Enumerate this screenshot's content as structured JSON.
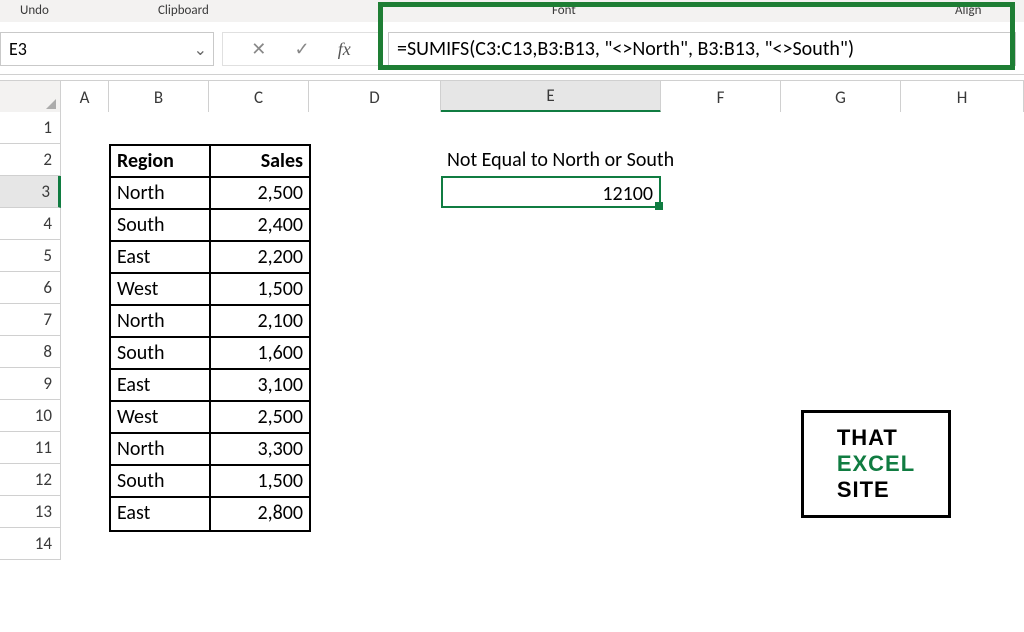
{
  "ribbon": {
    "undo": "Undo",
    "clipboard": "Clipboard",
    "font": "Font",
    "align": "Align"
  },
  "name_box": "E3",
  "formula_bar": "=SUMIFS(C3:C13,B3:B13, \"<>North\", B3:B13, \"<>South\")",
  "columns": {
    "A": "A",
    "B": "B",
    "C": "C",
    "D": "D",
    "E": "E",
    "F": "F",
    "G": "G",
    "H": "H"
  },
  "rows": {
    "1": "1",
    "2": "2",
    "3": "3",
    "4": "4",
    "5": "5",
    "6": "6",
    "7": "7",
    "8": "8",
    "9": "9",
    "10": "10",
    "11": "11",
    "12": "12",
    "13": "13",
    "14": "14"
  },
  "table": {
    "header": {
      "region": "Region",
      "sales": "Sales"
    },
    "rows": [
      {
        "region": "North",
        "sales": "2,500"
      },
      {
        "region": "South",
        "sales": "2,400"
      },
      {
        "region": "East",
        "sales": "2,200"
      },
      {
        "region": "West",
        "sales": "1,500"
      },
      {
        "region": "North",
        "sales": "2,100"
      },
      {
        "region": "South",
        "sales": "1,600"
      },
      {
        "region": "East",
        "sales": "3,100"
      },
      {
        "region": "West",
        "sales": "2,500"
      },
      {
        "region": "North",
        "sales": "3,300"
      },
      {
        "region": "South",
        "sales": "1,500"
      },
      {
        "region": "East",
        "sales": "2,800"
      }
    ]
  },
  "output": {
    "label": "Not Equal to North or South",
    "value": "12100"
  },
  "logo": {
    "l1": "THAT",
    "l2": "EXCEL",
    "l3": "SITE"
  }
}
